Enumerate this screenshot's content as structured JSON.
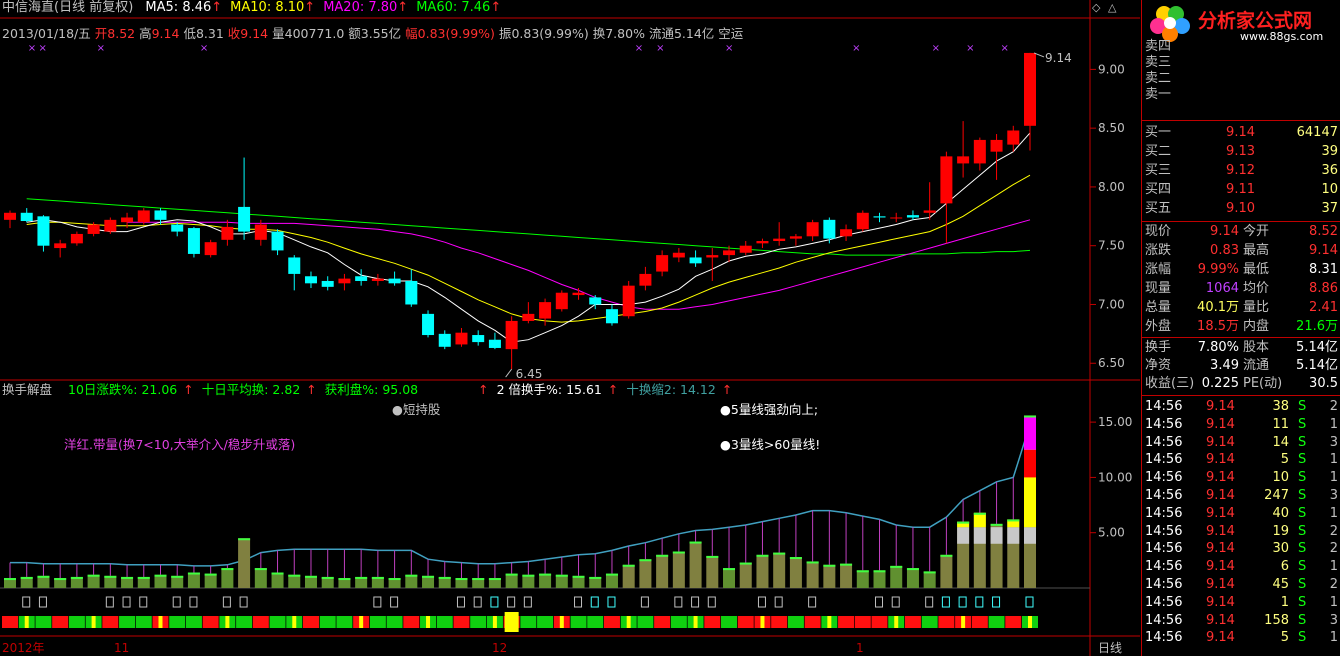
{
  "header": {
    "title": "中信海直(日线 前复权)",
    "ma": [
      {
        "label": "MA5: 8.46",
        "color": "#ffffff"
      },
      {
        "label": "MA10: 8.10",
        "color": "#ffff00"
      },
      {
        "label": "MA20: 7.80",
        "color": "#ff00ff"
      },
      {
        "label": "MA60: 7.46",
        "color": "#00ff00"
      }
    ],
    "quote": {
      "date": "2013/01/18/五",
      "open_l": "开",
      "open": "8.52",
      "high_l": "高",
      "high": "9.14",
      "low_l": "低",
      "low": "8.31",
      "close_l": "收",
      "close": "9.14",
      "vol_l": "量",
      "vol": "400771.0",
      "amt_l": "额",
      "amt": "3.55亿",
      "rng_l": "幅",
      "rng": "0.83(9.99%)",
      "amp_l": "振",
      "amp": "0.83(9.99%)",
      "turn_l": "换",
      "turn": "7.80%",
      "float_l": "流通",
      "float": "5.14亿",
      "status": "空运"
    }
  },
  "chart_data": [
    {
      "type": "candlestick",
      "ylim": [
        6.4,
        9.25
      ],
      "yticks": [
        "9.00",
        "8.50",
        "8.00",
        "7.50",
        "7.00",
        "6.50"
      ],
      "annotations": {
        "high_label": "9.14",
        "low_label": "6.45"
      },
      "candles": [
        {
          "o": 7.72,
          "h": 7.8,
          "l": 7.65,
          "c": 7.78
        },
        {
          "o": 7.78,
          "h": 7.82,
          "l": 7.7,
          "c": 7.71
        },
        {
          "o": 7.75,
          "h": 7.76,
          "l": 7.45,
          "c": 7.5
        },
        {
          "o": 7.48,
          "h": 7.55,
          "l": 7.4,
          "c": 7.52
        },
        {
          "o": 7.52,
          "h": 7.62,
          "l": 7.5,
          "c": 7.6
        },
        {
          "o": 7.6,
          "h": 7.7,
          "l": 7.58,
          "c": 7.68
        },
        {
          "o": 7.62,
          "h": 7.74,
          "l": 7.6,
          "c": 7.72
        },
        {
          "o": 7.7,
          "h": 7.78,
          "l": 7.65,
          "c": 7.74
        },
        {
          "o": 7.7,
          "h": 7.82,
          "l": 7.68,
          "c": 7.8
        },
        {
          "o": 7.8,
          "h": 7.82,
          "l": 7.68,
          "c": 7.72
        },
        {
          "o": 7.68,
          "h": 7.7,
          "l": 7.58,
          "c": 7.62
        },
        {
          "o": 7.65,
          "h": 7.66,
          "l": 7.4,
          "c": 7.43
        },
        {
          "o": 7.42,
          "h": 7.55,
          "l": 7.4,
          "c": 7.53
        },
        {
          "o": 7.55,
          "h": 7.72,
          "l": 7.5,
          "c": 7.66
        },
        {
          "o": 7.83,
          "h": 8.25,
          "l": 7.55,
          "c": 7.62
        },
        {
          "o": 7.55,
          "h": 7.72,
          "l": 7.5,
          "c": 7.68
        },
        {
          "o": 7.62,
          "h": 7.64,
          "l": 7.42,
          "c": 7.46
        },
        {
          "o": 7.4,
          "h": 7.42,
          "l": 7.12,
          "c": 7.26
        },
        {
          "o": 7.24,
          "h": 7.28,
          "l": 7.14,
          "c": 7.18
        },
        {
          "o": 7.2,
          "h": 7.24,
          "l": 7.12,
          "c": 7.15
        },
        {
          "o": 7.18,
          "h": 7.26,
          "l": 7.12,
          "c": 7.22
        },
        {
          "o": 7.24,
          "h": 7.3,
          "l": 7.16,
          "c": 7.2
        },
        {
          "o": 7.2,
          "h": 7.26,
          "l": 7.16,
          "c": 7.22
        },
        {
          "o": 7.22,
          "h": 7.28,
          "l": 7.16,
          "c": 7.18
        },
        {
          "o": 7.2,
          "h": 7.3,
          "l": 6.98,
          "c": 7.0
        },
        {
          "o": 6.92,
          "h": 6.95,
          "l": 6.72,
          "c": 6.74
        },
        {
          "o": 6.75,
          "h": 6.78,
          "l": 6.62,
          "c": 6.64
        },
        {
          "o": 6.66,
          "h": 6.8,
          "l": 6.64,
          "c": 6.76
        },
        {
          "o": 6.74,
          "h": 6.78,
          "l": 6.65,
          "c": 6.68
        },
        {
          "o": 6.7,
          "h": 6.76,
          "l": 6.62,
          "c": 6.63
        },
        {
          "o": 6.62,
          "h": 6.9,
          "l": 6.45,
          "c": 6.86
        },
        {
          "o": 6.86,
          "h": 7.02,
          "l": 6.84,
          "c": 6.92
        },
        {
          "o": 6.88,
          "h": 7.05,
          "l": 6.82,
          "c": 7.02
        },
        {
          "o": 6.96,
          "h": 7.12,
          "l": 6.94,
          "c": 7.1
        },
        {
          "o": 7.08,
          "h": 7.14,
          "l": 7.04,
          "c": 7.1
        },
        {
          "o": 7.06,
          "h": 7.08,
          "l": 6.96,
          "c": 7.0
        },
        {
          "o": 6.96,
          "h": 7.0,
          "l": 6.82,
          "c": 6.84
        },
        {
          "o": 6.9,
          "h": 7.2,
          "l": 6.88,
          "c": 7.16
        },
        {
          "o": 7.16,
          "h": 7.32,
          "l": 7.12,
          "c": 7.26
        },
        {
          "o": 7.28,
          "h": 7.46,
          "l": 7.24,
          "c": 7.42
        },
        {
          "o": 7.4,
          "h": 7.48,
          "l": 7.36,
          "c": 7.44
        },
        {
          "o": 7.4,
          "h": 7.46,
          "l": 7.32,
          "c": 7.35
        },
        {
          "o": 7.4,
          "h": 7.48,
          "l": 7.2,
          "c": 7.42
        },
        {
          "o": 7.42,
          "h": 7.5,
          "l": 7.36,
          "c": 7.46
        },
        {
          "o": 7.44,
          "h": 7.54,
          "l": 7.42,
          "c": 7.5
        },
        {
          "o": 7.52,
          "h": 7.56,
          "l": 7.48,
          "c": 7.54
        },
        {
          "o": 7.54,
          "h": 7.7,
          "l": 7.5,
          "c": 7.56
        },
        {
          "o": 7.56,
          "h": 7.6,
          "l": 7.5,
          "c": 7.58
        },
        {
          "o": 7.58,
          "h": 7.72,
          "l": 7.54,
          "c": 7.7
        },
        {
          "o": 7.72,
          "h": 7.74,
          "l": 7.52,
          "c": 7.56
        },
        {
          "o": 7.58,
          "h": 7.68,
          "l": 7.54,
          "c": 7.64
        },
        {
          "o": 7.64,
          "h": 7.8,
          "l": 7.62,
          "c": 7.78
        },
        {
          "o": 7.75,
          "h": 7.78,
          "l": 7.7,
          "c": 7.74
        },
        {
          "o": 7.74,
          "h": 7.78,
          "l": 7.7,
          "c": 7.74
        },
        {
          "o": 7.76,
          "h": 7.8,
          "l": 7.72,
          "c": 7.74
        },
        {
          "o": 7.78,
          "h": 8.04,
          "l": 7.72,
          "c": 7.8
        },
        {
          "o": 7.86,
          "h": 8.3,
          "l": 7.52,
          "c": 8.26
        },
        {
          "o": 8.2,
          "h": 8.56,
          "l": 8.08,
          "c": 8.26
        },
        {
          "o": 8.2,
          "h": 8.42,
          "l": 8.14,
          "c": 8.4
        },
        {
          "o": 8.3,
          "h": 8.45,
          "l": 8.06,
          "c": 8.4
        },
        {
          "o": 8.36,
          "h": 8.52,
          "l": 8.3,
          "c": 8.48
        },
        {
          "o": 8.52,
          "h": 9.14,
          "l": 8.31,
          "c": 9.14
        }
      ],
      "ma": {
        "ma5": [
          7.7,
          7.72,
          7.7,
          7.66,
          7.64,
          7.62,
          7.62,
          7.66,
          7.7,
          7.72,
          7.71,
          7.66,
          7.6,
          7.6,
          7.63,
          7.61,
          7.55,
          7.49,
          7.44,
          7.34,
          7.25,
          7.22,
          7.2,
          7.2,
          7.15,
          7.06,
          6.96,
          6.86,
          6.78,
          6.68,
          6.7,
          6.76,
          6.82,
          6.9,
          7.0,
          7.0,
          7.0,
          7.02,
          7.07,
          7.13,
          7.24,
          7.3,
          7.37,
          7.41,
          7.43,
          7.47,
          7.49,
          7.52,
          7.55,
          7.59,
          7.62,
          7.65,
          7.68,
          7.72,
          7.74,
          7.86,
          7.98,
          8.1,
          8.22,
          8.3,
          8.46
        ],
        "ma10": [
          7.68,
          7.7,
          7.7,
          7.69,
          7.68,
          7.67,
          7.67,
          7.67,
          7.68,
          7.69,
          7.68,
          7.67,
          7.65,
          7.64,
          7.64,
          7.63,
          7.6,
          7.57,
          7.53,
          7.48,
          7.43,
          7.39,
          7.35,
          7.3,
          7.25,
          7.18,
          7.11,
          7.04,
          6.98,
          6.92,
          6.88,
          6.86,
          6.85,
          6.86,
          6.88,
          6.9,
          6.92,
          6.94,
          6.97,
          7.02,
          7.08,
          7.14,
          7.19,
          7.23,
          7.27,
          7.31,
          7.36,
          7.4,
          7.44,
          7.47,
          7.5,
          7.53,
          7.56,
          7.59,
          7.62,
          7.68,
          7.75,
          7.84,
          7.93,
          8.02,
          8.1
        ],
        "ma20": [
          7.7,
          7.7,
          7.7,
          7.7,
          7.7,
          7.7,
          7.7,
          7.69,
          7.69,
          7.69,
          7.69,
          7.68,
          7.67,
          7.66,
          7.65,
          7.64,
          7.62,
          7.6,
          7.57,
          7.53,
          7.48,
          7.44,
          7.39,
          7.34,
          7.29,
          7.23,
          7.17,
          7.12,
          7.06,
          7.02,
          6.98,
          6.96,
          6.96,
          6.96,
          6.98,
          7.0,
          7.03,
          7.06,
          7.09,
          7.12,
          7.16,
          7.2,
          7.24,
          7.28,
          7.32,
          7.36,
          7.4,
          7.44,
          7.48,
          7.52,
          7.56,
          7.6,
          7.64,
          7.68,
          7.72
        ],
        "ma60": [
          7.9,
          7.89,
          7.88,
          7.87,
          7.86,
          7.85,
          7.84,
          7.83,
          7.82,
          7.81,
          7.8,
          7.79,
          7.78,
          7.77,
          7.76,
          7.75,
          7.74,
          7.73,
          7.72,
          7.71,
          7.7,
          7.69,
          7.68,
          7.67,
          7.66,
          7.65,
          7.64,
          7.63,
          7.62,
          7.61,
          7.6,
          7.59,
          7.58,
          7.57,
          7.56,
          7.55,
          7.54,
          7.53,
          7.52,
          7.51,
          7.5,
          7.49,
          7.48,
          7.47,
          7.46,
          7.45,
          7.44,
          7.43,
          7.43,
          7.42,
          7.42,
          7.42,
          7.42,
          7.43,
          7.43,
          7.43,
          7.44,
          7.44,
          7.45,
          7.45,
          7.46
        ]
      },
      "markers_x": [
        1,
        2,
        5,
        11,
        37,
        39,
        43,
        50,
        55,
        57,
        59
      ]
    },
    {
      "type": "bar",
      "ylim": [
        0,
        17
      ],
      "yticks": [
        "15.00",
        "10.00",
        "5.00"
      ],
      "values": [
        0.9,
        1.0,
        1.1,
        0.9,
        1.0,
        1.2,
        1.1,
        1.0,
        1.0,
        1.2,
        1.1,
        1.4,
        1.3,
        1.8,
        4.5,
        1.8,
        1.4,
        1.2,
        1.1,
        1.0,
        0.9,
        1.0,
        1.0,
        0.9,
        1.2,
        1.1,
        1.0,
        0.9,
        0.9,
        0.9,
        1.3,
        1.2,
        1.3,
        1.2,
        1.1,
        1.0,
        1.3,
        2.1,
        2.6,
        3.0,
        3.3,
        4.2,
        2.9,
        1.8,
        2.3,
        3.0,
        3.2,
        2.8,
        2.4,
        2.1,
        2.2,
        1.6,
        1.6,
        2.0,
        1.8,
        1.5,
        3.0,
        6.0,
        6.8,
        5.8,
        6.2,
        15.6
      ],
      "line_values": [
        2.3,
        2.3,
        2.2,
        2.2,
        2.2,
        2.2,
        2.2,
        2.1,
        2.1,
        2.1,
        2.1,
        2.0,
        2.0,
        2.1,
        2.5,
        3.2,
        3.4,
        3.5,
        3.5,
        3.5,
        3.5,
        3.5,
        3.4,
        3.4,
        3.4,
        2.6,
        2.4,
        2.3,
        2.2,
        2.2,
        2.3,
        2.4,
        2.6,
        2.8,
        3.0,
        3.1,
        3.4,
        3.8,
        4.1,
        4.5,
        4.9,
        5.2,
        5.3,
        5.5,
        5.7,
        6.0,
        6.3,
        6.6,
        7.0,
        7.0,
        6.8,
        6.5,
        6.2,
        5.7,
        5.5,
        5.5,
        6.4,
        8.0,
        8.8,
        9.6,
        10.0,
        14.8
      ]
    }
  ],
  "indicator": {
    "name": "换手解盘",
    "items": [
      {
        "label": "10日涨跌%: 21.06",
        "color": "#00ff00"
      },
      {
        "label": "十日平均换: 2.82",
        "color": "#00ff00"
      },
      {
        "label": "获利盘%: 95.08",
        "color": "#00ff00"
      },
      {
        "label": "2 倍换手%: 15.61",
        "color": "#ffffff"
      },
      {
        "label": "十换缩2: 14.12",
        "color": "#40a0a0"
      }
    ],
    "signal_short": "●短持股",
    "signal_a": "●5量线强劲向上;",
    "signal_b": "●3量线>60量线!",
    "note": "洋红.带量(换7<10,大举介入/稳步升或落)"
  },
  "time_axis": {
    "year_label": "2012年",
    "months": [
      "11",
      "12",
      "1"
    ],
    "period": "日线"
  },
  "logo": {
    "text": "分析家公式网",
    "url": "www.88gs.com"
  },
  "panel": {
    "asks_partial": [
      "卖四",
      "卖三",
      "卖二",
      "卖一"
    ],
    "bids": [
      {
        "label": "买一",
        "price": "9.14",
        "vol": "64147"
      },
      {
        "label": "买二",
        "price": "9.13",
        "vol": "39"
      },
      {
        "label": "买三",
        "price": "9.12",
        "vol": "36"
      },
      {
        "label": "买四",
        "price": "9.11",
        "vol": "10"
      },
      {
        "label": "买五",
        "price": "9.10",
        "vol": "37"
      }
    ],
    "stats": [
      {
        "l1": "现价",
        "v1": "9.14",
        "c1": "#ff3030",
        "l2": "今开",
        "v2": "8.52",
        "c2": "#ff3030"
      },
      {
        "l1": "涨跌",
        "v1": "0.83",
        "c1": "#ff3030",
        "l2": "最高",
        "v2": "9.14",
        "c2": "#ff3030"
      },
      {
        "l1": "涨幅",
        "v1": "9.99%",
        "c1": "#ff3030",
        "l2": "最低",
        "v2": "8.31",
        "c2": "#ffffff"
      },
      {
        "l1": "现量",
        "v1": "1064",
        "c1": "#c040ff",
        "l2": "均价",
        "v2": "8.86",
        "c2": "#ff3030"
      },
      {
        "l1": "总量",
        "v1": "40.1万",
        "c1": "#ffff60",
        "l2": "量比",
        "v2": "2.41",
        "c2": "#ff3030"
      },
      {
        "l1": "外盘",
        "v1": "18.5万",
        "c1": "#ff3030",
        "l2": "内盘",
        "v2": "21.6万",
        "c2": "#00ff00"
      }
    ],
    "fund": [
      {
        "l1": "换手",
        "v1": "7.80%",
        "l2": "股本",
        "v2": "5.14亿"
      },
      {
        "l1": "净资",
        "v1": "3.49",
        "l2": "流通",
        "v2": "5.14亿"
      },
      {
        "l1": "收益(三)",
        "v1": "0.225",
        "l2": "PE(动)",
        "v2": "30.5"
      }
    ],
    "ticks": [
      {
        "time": "14:56",
        "price": "9.14",
        "vol": "38",
        "bs": "S",
        "n": "2"
      },
      {
        "time": "14:56",
        "price": "9.14",
        "vol": "11",
        "bs": "S",
        "n": "1"
      },
      {
        "time": "14:56",
        "price": "9.14",
        "vol": "14",
        "bs": "S",
        "n": "3"
      },
      {
        "time": "14:56",
        "price": "9.14",
        "vol": "5",
        "bs": "S",
        "n": "1"
      },
      {
        "time": "14:56",
        "price": "9.14",
        "vol": "10",
        "bs": "S",
        "n": "1"
      },
      {
        "time": "14:56",
        "price": "9.14",
        "vol": "247",
        "bs": "S",
        "n": "3"
      },
      {
        "time": "14:56",
        "price": "9.14",
        "vol": "40",
        "bs": "S",
        "n": "1"
      },
      {
        "time": "14:56",
        "price": "9.14",
        "vol": "19",
        "bs": "S",
        "n": "2"
      },
      {
        "time": "14:56",
        "price": "9.14",
        "vol": "30",
        "bs": "S",
        "n": "2"
      },
      {
        "time": "14:56",
        "price": "9.14",
        "vol": "6",
        "bs": "S",
        "n": "1"
      },
      {
        "time": "14:56",
        "price": "9.14",
        "vol": "45",
        "bs": "S",
        "n": "2"
      },
      {
        "time": "14:56",
        "price": "9.14",
        "vol": "1",
        "bs": "S",
        "n": "1"
      },
      {
        "time": "14:56",
        "price": "9.14",
        "vol": "158",
        "bs": "S",
        "n": "3"
      },
      {
        "time": "14:56",
        "price": "9.14",
        "vol": "5",
        "bs": "S",
        "n": "1"
      }
    ]
  },
  "colors": {
    "up": "#ff0000",
    "down": "#00ffff",
    "grid": "#c00000",
    "label": "#c0c0c0",
    "ma5": "#ffffff",
    "ma10": "#ffff00",
    "ma20": "#ff00ff",
    "ma60": "#00ff00"
  }
}
